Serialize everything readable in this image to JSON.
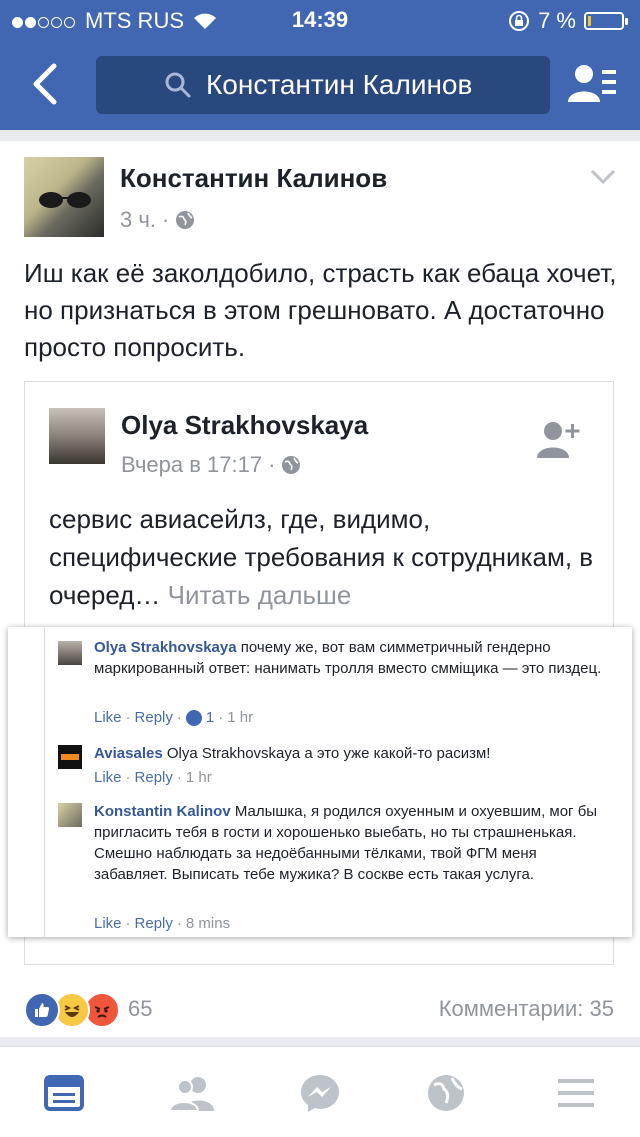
{
  "status_bar": {
    "carrier": "MTS RUS",
    "time": "14:39",
    "battery": "7 %",
    "battery_level_percent": 7
  },
  "nav": {
    "search_text": "Константин Калинов"
  },
  "post": {
    "author": "Константин Калинов",
    "time": "3 ч.",
    "text": "Иш как её заколдобило, страсть как ебаца хочет, но признаться в этом грешновато. А достаточно просто попросить.",
    "shared": {
      "author": "Olya Strakhovskaya",
      "time": "Вчера в 17:17",
      "text": "сервис авиасейлз, где, видимо, специфические требования к сотрудникам, в очеред…",
      "read_more": "Читать дальше",
      "comments": [
        {
          "author": "Olya Strakhovskaya",
          "text": "почему же, вот вам симметричный гендерно маркированный ответ: нанимать тролля вместо смміщика — это пиздец.",
          "like": "Like",
          "reply": "Reply",
          "likes": "1",
          "time": "1 hr"
        },
        {
          "author": "Aviasales",
          "text": "Olya Strakhovskaya а это уже какой-то расизм!",
          "like": "Like",
          "reply": "Reply",
          "time": "1 hr"
        },
        {
          "author": "Konstantin Kalinov",
          "text": "Малышка, я родился охуенным и охуевшим, мог бы пригласить тебя в гости и хорошенько выебать, но ты страшненькая. Смешно наблюдать за недоёбанными тёлками, твой ФГМ меня забавляет. Выписать тебе мужика? В соскве есть такая услуга.",
          "like": "Like",
          "reply": "Reply",
          "time": "8 mins"
        }
      ]
    },
    "reaction_count": "65",
    "comments_label": "Комментарии: 35"
  },
  "colors": {
    "brand": "#4267b2",
    "link": "#365899",
    "muted": "#90949c"
  }
}
